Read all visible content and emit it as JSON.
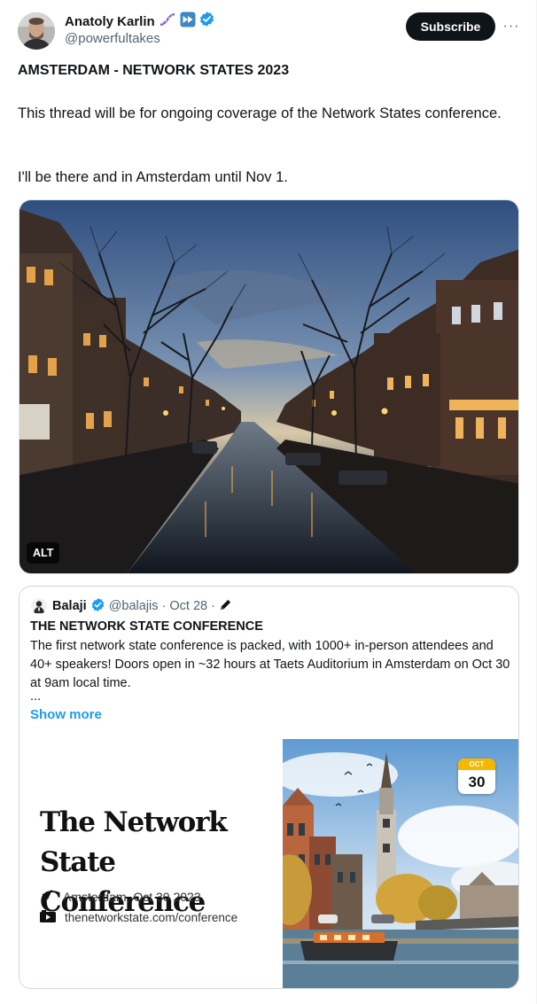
{
  "author": {
    "display_name": "Anatoly Karlin",
    "handle": "@powerfultakes"
  },
  "actions": {
    "subscribe_label": "Subscribe",
    "more_label": "···"
  },
  "post": {
    "title": "AMSTERDAM - NETWORK STATES 2023",
    "paragraph_1": "This thread will be for ongoing coverage of the Network States conference.",
    "paragraph_2": "I'll be there and in Amsterdam until Nov 1.",
    "image_alt_badge": "ALT"
  },
  "quote": {
    "name": "Balaji",
    "meta": "@balajis · Oct 28 ·",
    "title": "THE NETWORK STATE CONFERENCE",
    "text": "The first network state conference is packed, with 1000+ in-person attendees and 40+ speakers! Doors open in ~32 hours at Taets Auditorium in Amsterdam on Oct 30 at 9am local time.",
    "ellipsis": "...",
    "show_more": "Show more"
  },
  "promo": {
    "title_line_1": "The Network",
    "title_line_2": "State Conference",
    "location": "Amsterdam, Oct 30 2023",
    "url": "thenetworkstate.com/conference",
    "calendar_month": "OCT",
    "calendar_day": "30"
  },
  "colors": {
    "accent": "#1d9bf0",
    "verified": "#1d9bf0",
    "text": "#0f1419",
    "secondary_text": "#536471"
  }
}
